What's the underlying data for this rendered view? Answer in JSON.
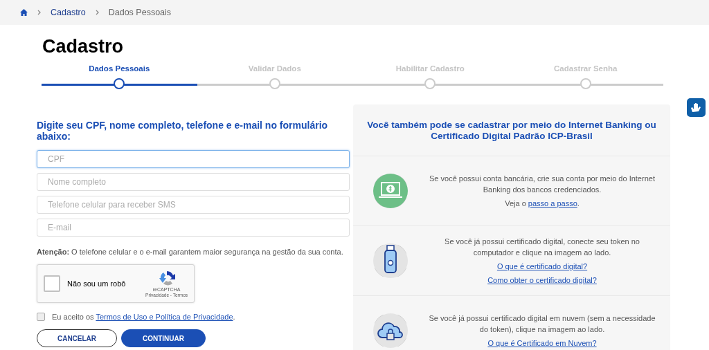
{
  "breadcrumb": [
    {
      "kind": "home"
    },
    {
      "kind": "link",
      "label": "Cadastro"
    },
    {
      "kind": "current",
      "label": "Dados Pessoais"
    }
  ],
  "title": "Cadastro",
  "steps": [
    {
      "label": "Dados Pessoais",
      "selected": true
    },
    {
      "label": "Validar Dados",
      "selected": false
    },
    {
      "label": "Habilitar Cadastro",
      "selected": false
    },
    {
      "label": "Cadastrar Senha",
      "selected": false
    }
  ],
  "progress": {
    "level": 0.25
  },
  "form": {
    "heading": "Digite seu CPF, nome completo, telefone e e-mail no formulário abaixo:",
    "fields": [
      {
        "placeholder": "CPF",
        "focused": true
      },
      {
        "placeholder": "Nome completo",
        "focused": false
      },
      {
        "placeholder": "Telefone celular para receber SMS",
        "focused": false
      },
      {
        "placeholder": "E-mail",
        "focused": false
      }
    ],
    "notice": "**Atenção:** O telefone celular e o e-mail garantem maior segurança na gestão da sua conta.",
    "captcha": {
      "label": "Não sou um robô",
      "checked": false,
      "brand": "reCAPTCHA",
      "footer": "Privacidade - Termos"
    },
    "terms": {
      "checked": false,
      "prefix": "Eu aceito os",
      "link": "Termos de Uso e Política de Privacidade",
      "suffix": "."
    },
    "buttons": [
      {
        "label": "CANCELAR",
        "kind": "secondary"
      },
      {
        "label": "CONTINUAR",
        "kind": "primary"
      }
    ]
  },
  "panel": {
    "heading": "Você também pode se cadastrar por meio do Internet Banking ou Certificado Digital Padrão ICP-Brasil",
    "options": [
      {
        "kind": "bank",
        "text": "Se você possui conta bancária, crie sua conta por meio do Internet Banking dos bancos credenciados.",
        "links": [
          {
            "prefix": "Veja o",
            "label": "passo a passo",
            "suffix": "."
          }
        ]
      },
      {
        "kind": "token",
        "text": "Se você já possui certificado digital, conecte seu token no computador e clique na imagem ao lado.",
        "links": [
          {
            "label": "O que é certificado digital?"
          },
          {
            "label": "Como obter o certificado digital?"
          }
        ]
      },
      {
        "kind": "cloud",
        "text": "Se você já possui certificado digital em nuvem (sem a necessidade do token), clique na imagem ao lado.",
        "links": [
          {
            "label": "O que é Certificado em Nuvem?"
          }
        ]
      }
    ]
  }
}
